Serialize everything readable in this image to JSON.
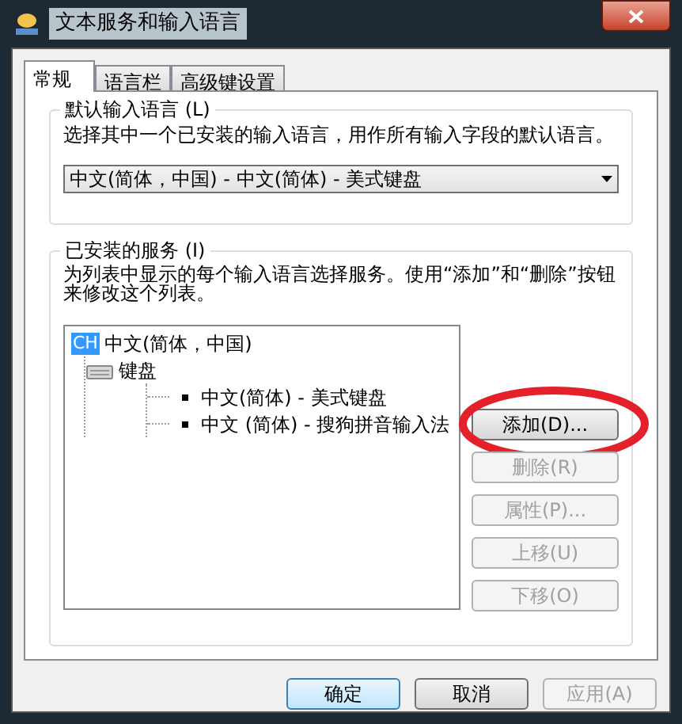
{
  "window": {
    "title": "文本服务和输入语言"
  },
  "tabs": [
    {
      "label": "常规",
      "selected": true
    },
    {
      "label": "语言栏",
      "selected": false
    },
    {
      "label": "高级键设置",
      "selected": false
    }
  ],
  "default_language": {
    "title": "默认输入语言 (L)",
    "description": "选择其中一个已安装的输入语言，用作所有输入字段的默认语言。",
    "dropdown": {
      "value": "中文(简体，中国) - 中文(简体) - 美式键盘"
    }
  },
  "installed_services": {
    "title": "已安装的服务 (I)",
    "description": "为列表中显示的每个输入语言选择服务。使用“添加”和“删除”按钮来修改这个列表。",
    "tree": [
      {
        "badge": "CH",
        "label": "中文(简体，中国)",
        "children": [
          {
            "label": "键盘",
            "children": [
              {
                "label": "中文(简体) - 美式键盘"
              },
              {
                "label": "中文 (简体) - 搜狗拼音输入法"
              }
            ]
          }
        ]
      }
    ],
    "buttons": [
      {
        "label": "添加(D)...",
        "disabled": false,
        "circled": true
      },
      {
        "label": "删除(R)",
        "disabled": true,
        "circled": false
      },
      {
        "label": "属性(P)...",
        "disabled": true,
        "circled": false
      },
      {
        "label": "上移(U)",
        "disabled": true,
        "circled": false
      },
      {
        "label": "下移(O)",
        "disabled": true,
        "circled": false
      }
    ]
  },
  "footer_buttons": [
    {
      "label": "确定",
      "default": true,
      "disabled": false
    },
    {
      "label": "取消",
      "default": false,
      "disabled": false
    },
    {
      "label": "应用(A)",
      "default": false,
      "disabled": true
    }
  ]
}
